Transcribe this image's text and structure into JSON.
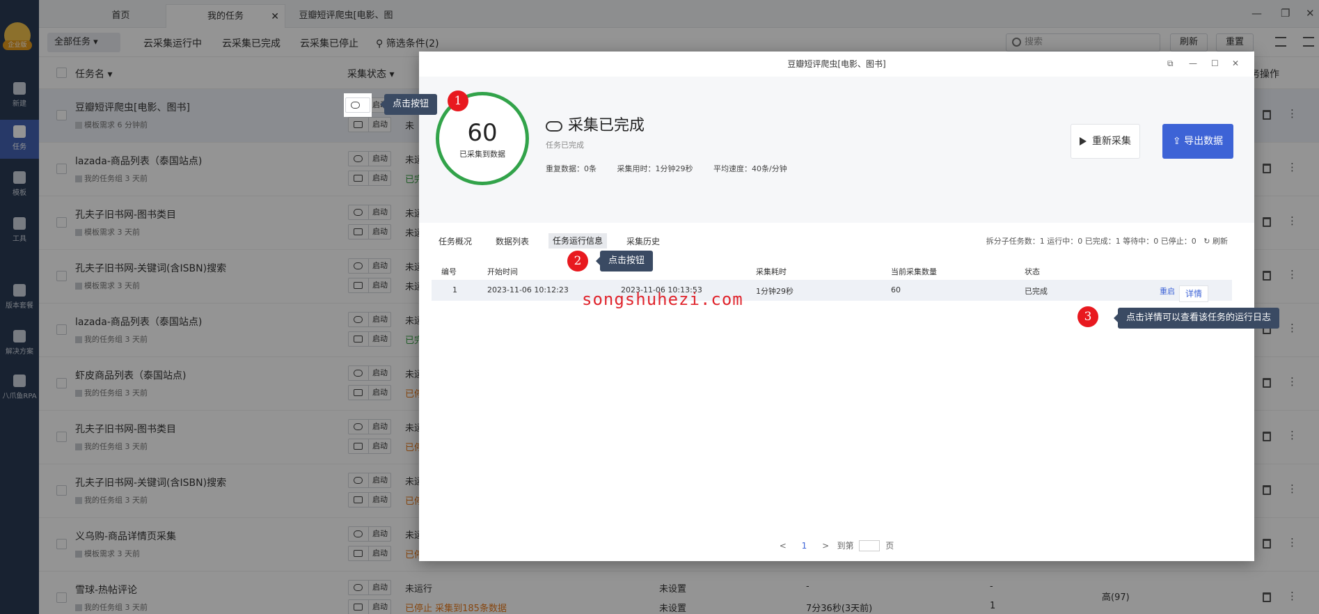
{
  "sidebar": {
    "logo_badge": "企业版",
    "items": [
      {
        "label": "新建",
        "icon": "plus-icon"
      },
      {
        "label": "任务",
        "icon": "task-flag-icon"
      },
      {
        "label": "模板",
        "icon": "template-icon"
      },
      {
        "label": "工具",
        "icon": "toolbox-icon"
      },
      {
        "label": "版本套餐",
        "icon": "crown-icon"
      },
      {
        "label": "解决方案",
        "icon": "solution-icon"
      },
      {
        "label": "八爪鱼RPA",
        "icon": "octopus-icon"
      }
    ]
  },
  "tabs": [
    {
      "label": "首页"
    },
    {
      "label": "我的任务"
    },
    {
      "label": "豆瓣短评爬虫[电影、图书]"
    }
  ],
  "toolbar": {
    "filter_select": "全部任务",
    "links": [
      "云采集运行中",
      "云采集已完成",
      "云采集已停止",
      "筛选条件(2)"
    ],
    "search_placeholder": "搜索",
    "refresh": "刷新",
    "reset": "重置"
  },
  "list": {
    "col_name": "任务名",
    "col_status": "采集状态",
    "col_ops": "务操作",
    "start_label": "启动",
    "rows": [
      {
        "name": "豆瓣短评爬虫[电影、图书]",
        "meta": "模板需求  6 分钟前",
        "status1": "",
        "status2": "未",
        "s2class": ""
      },
      {
        "name": "lazada-商品列表（泰国站点)",
        "meta": "我的任务组  3 天前",
        "status1": "未运",
        "status2": "已完",
        "s2class": "green"
      },
      {
        "name": "孔夫子旧书网-图书类目",
        "meta": "模板需求  3 天前",
        "status1": "未运",
        "status2": "未运",
        "s2class": ""
      },
      {
        "name": "孔夫子旧书网-关键词(含ISBN)搜索",
        "meta": "模板需求  3 天前",
        "status1": "未运",
        "status2": "未运",
        "s2class": ""
      },
      {
        "name": "lazada-商品列表（泰国站点)",
        "meta": "我的任务组  3 天前",
        "status1": "未运",
        "status2": "已完",
        "s2class": "green"
      },
      {
        "name": "虾皮商品列表（泰国站点)",
        "meta": "我的任务组  3 天前",
        "status1": "未运",
        "status2": "已停",
        "s2class": "orange"
      },
      {
        "name": "孔夫子旧书网-图书类目",
        "meta": "我的任务组  3 天前",
        "status1": "未运",
        "status2": "已停",
        "s2class": "orange"
      },
      {
        "name": "孔夫子旧书网-关键词(含ISBN)搜索",
        "meta": "我的任务组  3 天前",
        "status1": "未运",
        "status2": "已停",
        "s2class": "orange"
      },
      {
        "name": "义乌购-商品详情页采集",
        "meta": "模板需求  3 天前",
        "status1": "未运",
        "status2": "已停",
        "s2class": "orange"
      },
      {
        "name": "雪球-热帖评论",
        "meta": "我的任务组  3 天前",
        "status1": "未运行",
        "status2": "已停止  采集到185条数据",
        "s2class": "orange"
      }
    ],
    "last_row_extra": {
      "setting1": "未设置",
      "setting2": "未设置",
      "dash1": "-",
      "duration": "7分36秒(3天前)",
      "dash2": "-",
      "count": "1",
      "priority": "高(97)"
    }
  },
  "modal": {
    "title": "豆瓣短评爬虫[电影、图书]",
    "collected_count": "60",
    "collected_label": "已采集到数据",
    "status_title": "采集已完成",
    "status_sub": "任务已完成",
    "stats": [
      "重复数据：0条",
      "采集用时：1分钟29秒",
      "平均速度：40条/分钟"
    ],
    "rerun": "重新采集",
    "export": "导出数据",
    "tabs": [
      "任务概况",
      "数据列表",
      "任务运行信息",
      "采集历史"
    ],
    "counters": "拆分子任务数：1   运行中：0   已完成：1   等待中：0   已停止：0",
    "refresh": "刷新",
    "table_headers": [
      "编号",
      "开始时间",
      "采集耗时",
      "当前采集数量",
      "状态"
    ],
    "table_row": {
      "id": "1",
      "start": "2023-11-06 10:12:23",
      "end": "2023-11-06 10:13:53",
      "elapsed": "1分钟29秒",
      "count": "60",
      "status": "已完成",
      "restart": "重启",
      "detail": "详情"
    },
    "pager": {
      "prev": "<",
      "current": "1",
      "next": ">",
      "goto": "到第",
      "page": "页"
    }
  },
  "watermark": "songshuhezi.com",
  "annotations": [
    {
      "num": "1",
      "text": "点击按钮"
    },
    {
      "num": "2",
      "text": "点击按钮"
    },
    {
      "num": "3",
      "text": "点击详情可以查看该任务的运行日志"
    }
  ],
  "colors": {
    "sidebar": "#2a3b55",
    "accent": "#3d63d6",
    "ring": "#32a34a",
    "bubble": "#e8191f",
    "watermark": "#e0252d"
  }
}
